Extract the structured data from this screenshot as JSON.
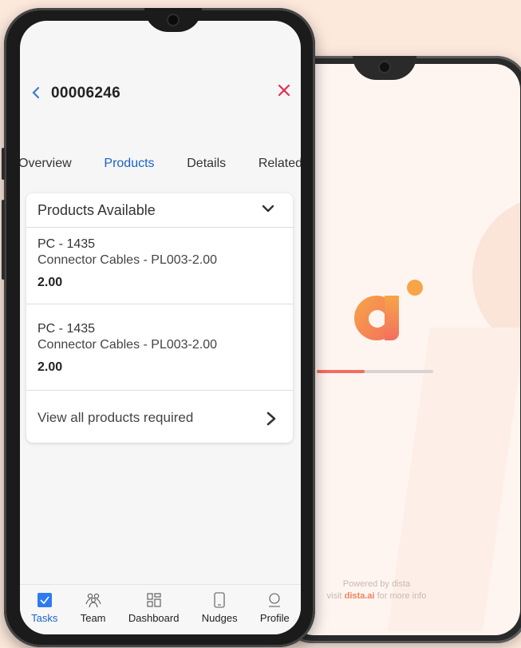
{
  "record": {
    "id": "00006246"
  },
  "tabs": [
    {
      "label": "Overview"
    },
    {
      "label": "Products"
    },
    {
      "label": "Details"
    },
    {
      "label": "Related"
    }
  ],
  "products_card": {
    "title": "Products Available",
    "items": [
      {
        "code": "PC - 1435",
        "name": "Connector Cables - PL003-2.00",
        "quantity": "2.00"
      },
      {
        "code": "PC - 1435",
        "name": "Connector Cables - PL003-2.00",
        "quantity": "2.00"
      }
    ],
    "view_all_label": "View all products required"
  },
  "bottom_nav": [
    {
      "label": "Tasks",
      "icon": "check-box-icon"
    },
    {
      "label": "Team",
      "icon": "team-icon"
    },
    {
      "label": "Dashboard",
      "icon": "dashboard-grid-icon"
    },
    {
      "label": "Nudges",
      "icon": "phone-icon"
    },
    {
      "label": "Profile",
      "icon": "profile-icon"
    }
  ],
  "splash": {
    "progress": 0.41,
    "powered_by": "Powered by dista",
    "visit_prefix": "visit",
    "visit_link": "dista.ai",
    "visit_suffix": "for more info"
  },
  "colors": {
    "accent": "#1a62c7",
    "close": "#e02e50",
    "brand": "#f36f5f"
  }
}
